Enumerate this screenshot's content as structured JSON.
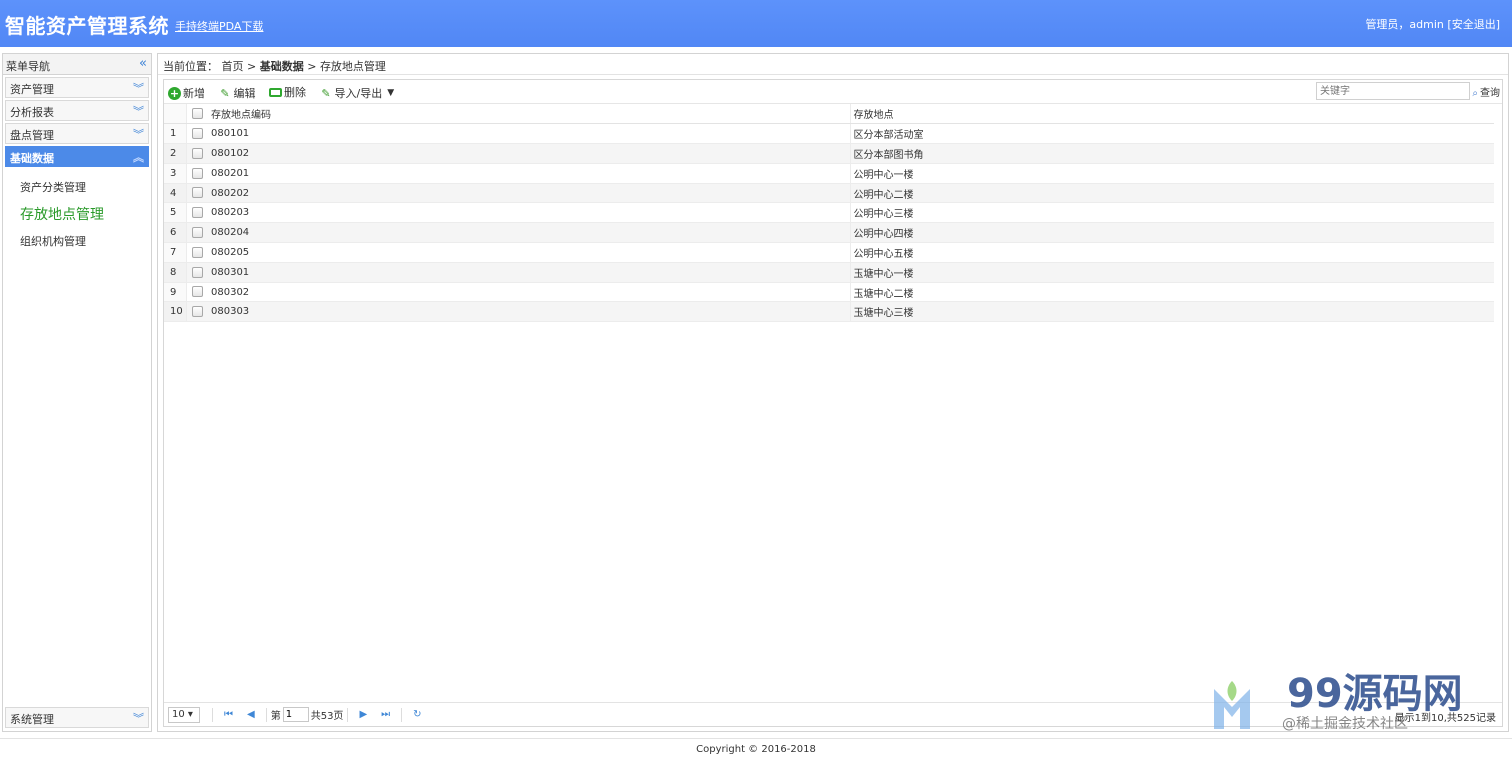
{
  "header": {
    "title": "智能资产管理系统",
    "pda_link": "手持终端PDA下载",
    "user_label": "管理员，admin",
    "logout": "[安全退出]"
  },
  "sidebar": {
    "title": "菜单导航",
    "collapse_icon": "double-chevron-left-icon",
    "groups": [
      {
        "label": "资产管理"
      },
      {
        "label": "分析报表"
      },
      {
        "label": "盘点管理"
      },
      {
        "label": "基础数据"
      }
    ],
    "sub_items": [
      {
        "label": "资产分类管理"
      },
      {
        "label": "存放地点管理"
      },
      {
        "label": "组织机构管理"
      }
    ],
    "bottom_group": {
      "label": "系统管理"
    }
  },
  "breadcrumb": {
    "prefix": "当前位置：",
    "home": "首页",
    "sep": ">",
    "section": "基础数据",
    "page": "存放地点管理"
  },
  "toolbar": {
    "add": "新增",
    "edit": "编辑",
    "delete": "删除",
    "import_export": "导入/导出",
    "search_placeholder": "关键字",
    "search": "查询"
  },
  "table": {
    "columns": [
      "存放地点编码",
      "存放地点"
    ],
    "rows": [
      {
        "n": "1",
        "code": "080101",
        "location": "区分本部活动室"
      },
      {
        "n": "2",
        "code": "080102",
        "location": "区分本部图书角"
      },
      {
        "n": "3",
        "code": "080201",
        "location": "公明中心一楼"
      },
      {
        "n": "4",
        "code": "080202",
        "location": "公明中心二楼"
      },
      {
        "n": "5",
        "code": "080203",
        "location": "公明中心三楼"
      },
      {
        "n": "6",
        "code": "080204",
        "location": "公明中心四楼"
      },
      {
        "n": "7",
        "code": "080205",
        "location": "公明中心五楼"
      },
      {
        "n": "8",
        "code": "080301",
        "location": "玉塘中心一楼"
      },
      {
        "n": "9",
        "code": "080302",
        "location": "玉塘中心二楼"
      },
      {
        "n": "10",
        "code": "080303",
        "location": "玉塘中心三楼"
      }
    ]
  },
  "pager": {
    "page_size": "10 ▾",
    "page_prefix": "第",
    "page_value": "1",
    "page_total": "共53页",
    "info": "显示1到10,共525记录"
  },
  "footer": {
    "copyright": "Copyright © 2016-2018"
  },
  "watermark": {
    "title": "99源码网",
    "sub": "@稀土掘金技术社区"
  },
  "colors": {
    "header_blue": "#5187f5",
    "active_blue": "#4c8ae8",
    "current_green": "#2a9a2a"
  }
}
